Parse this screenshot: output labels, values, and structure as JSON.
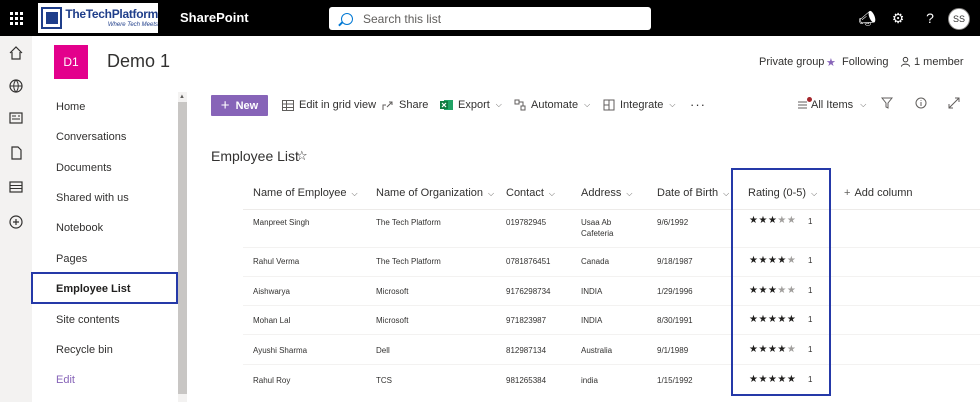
{
  "suite": {
    "brand_name": "TheTechPlatform",
    "brand_tagline": "Where Tech Meets",
    "app_name": "SharePoint",
    "search_placeholder": "Search this list",
    "user_initials": "SS"
  },
  "site": {
    "logo_initials": "D1",
    "logo_color": "#e3008c",
    "title": "Demo 1",
    "privacy": "Private group",
    "following": "Following",
    "members": "1 member"
  },
  "nav": {
    "items": [
      "Home",
      "Conversations",
      "Documents",
      "Shared with us",
      "Notebook",
      "Pages",
      "Employee List",
      "Site contents",
      "Recycle bin"
    ],
    "selected": "Employee List",
    "edit": "Edit"
  },
  "commands": {
    "new": "New",
    "grid": "Edit in grid view",
    "share": "Share",
    "export": "Export",
    "automate": "Automate",
    "integrate": "Integrate",
    "view": "All Items"
  },
  "list": {
    "title": "Employee List",
    "columns": [
      "Name of Employee",
      "Name of Organization",
      "Contact",
      "Address",
      "Date of Birth",
      "Rating (0-5)"
    ],
    "add_column": "Add column",
    "rows": [
      {
        "name": "Manpreet Singh",
        "org": "The Tech Platform",
        "contact": "019782945",
        "address_line1": "Usaa Ab",
        "address_line2": "Cafeteria",
        "dob": "9/6/1992",
        "rating": 3,
        "count": "1"
      },
      {
        "name": "Rahul Verma",
        "org": "The Tech Platform",
        "contact": "0781876451",
        "address_line1": "Canada",
        "address_line2": "",
        "dob": "9/18/1987",
        "rating": 4,
        "count": "1"
      },
      {
        "name": "Aishwarya",
        "org": "Microsoft",
        "contact": "9176298734",
        "address_line1": "INDIA",
        "address_line2": "",
        "dob": "1/29/1996",
        "rating": 3,
        "count": "1"
      },
      {
        "name": "Mohan Lal",
        "org": "Microsoft",
        "contact": "971823987",
        "address_line1": "INDIA",
        "address_line2": "",
        "dob": "8/30/1991",
        "rating": 5,
        "count": "1"
      },
      {
        "name": "Ayushi Sharma",
        "org": "Dell",
        "contact": "812987134",
        "address_line1": "Australia",
        "address_line2": "",
        "dob": "9/1/1989",
        "rating": 4,
        "count": "1"
      },
      {
        "name": "Rahul Roy",
        "org": "TCS",
        "contact": "981265384",
        "address_line1": "india",
        "address_line2": "",
        "dob": "1/15/1992",
        "rating": 5,
        "count": "1"
      }
    ]
  },
  "colors": {
    "accent": "#8764b8",
    "highlight_border": "#2539a8",
    "suite_bar": "#000000"
  }
}
